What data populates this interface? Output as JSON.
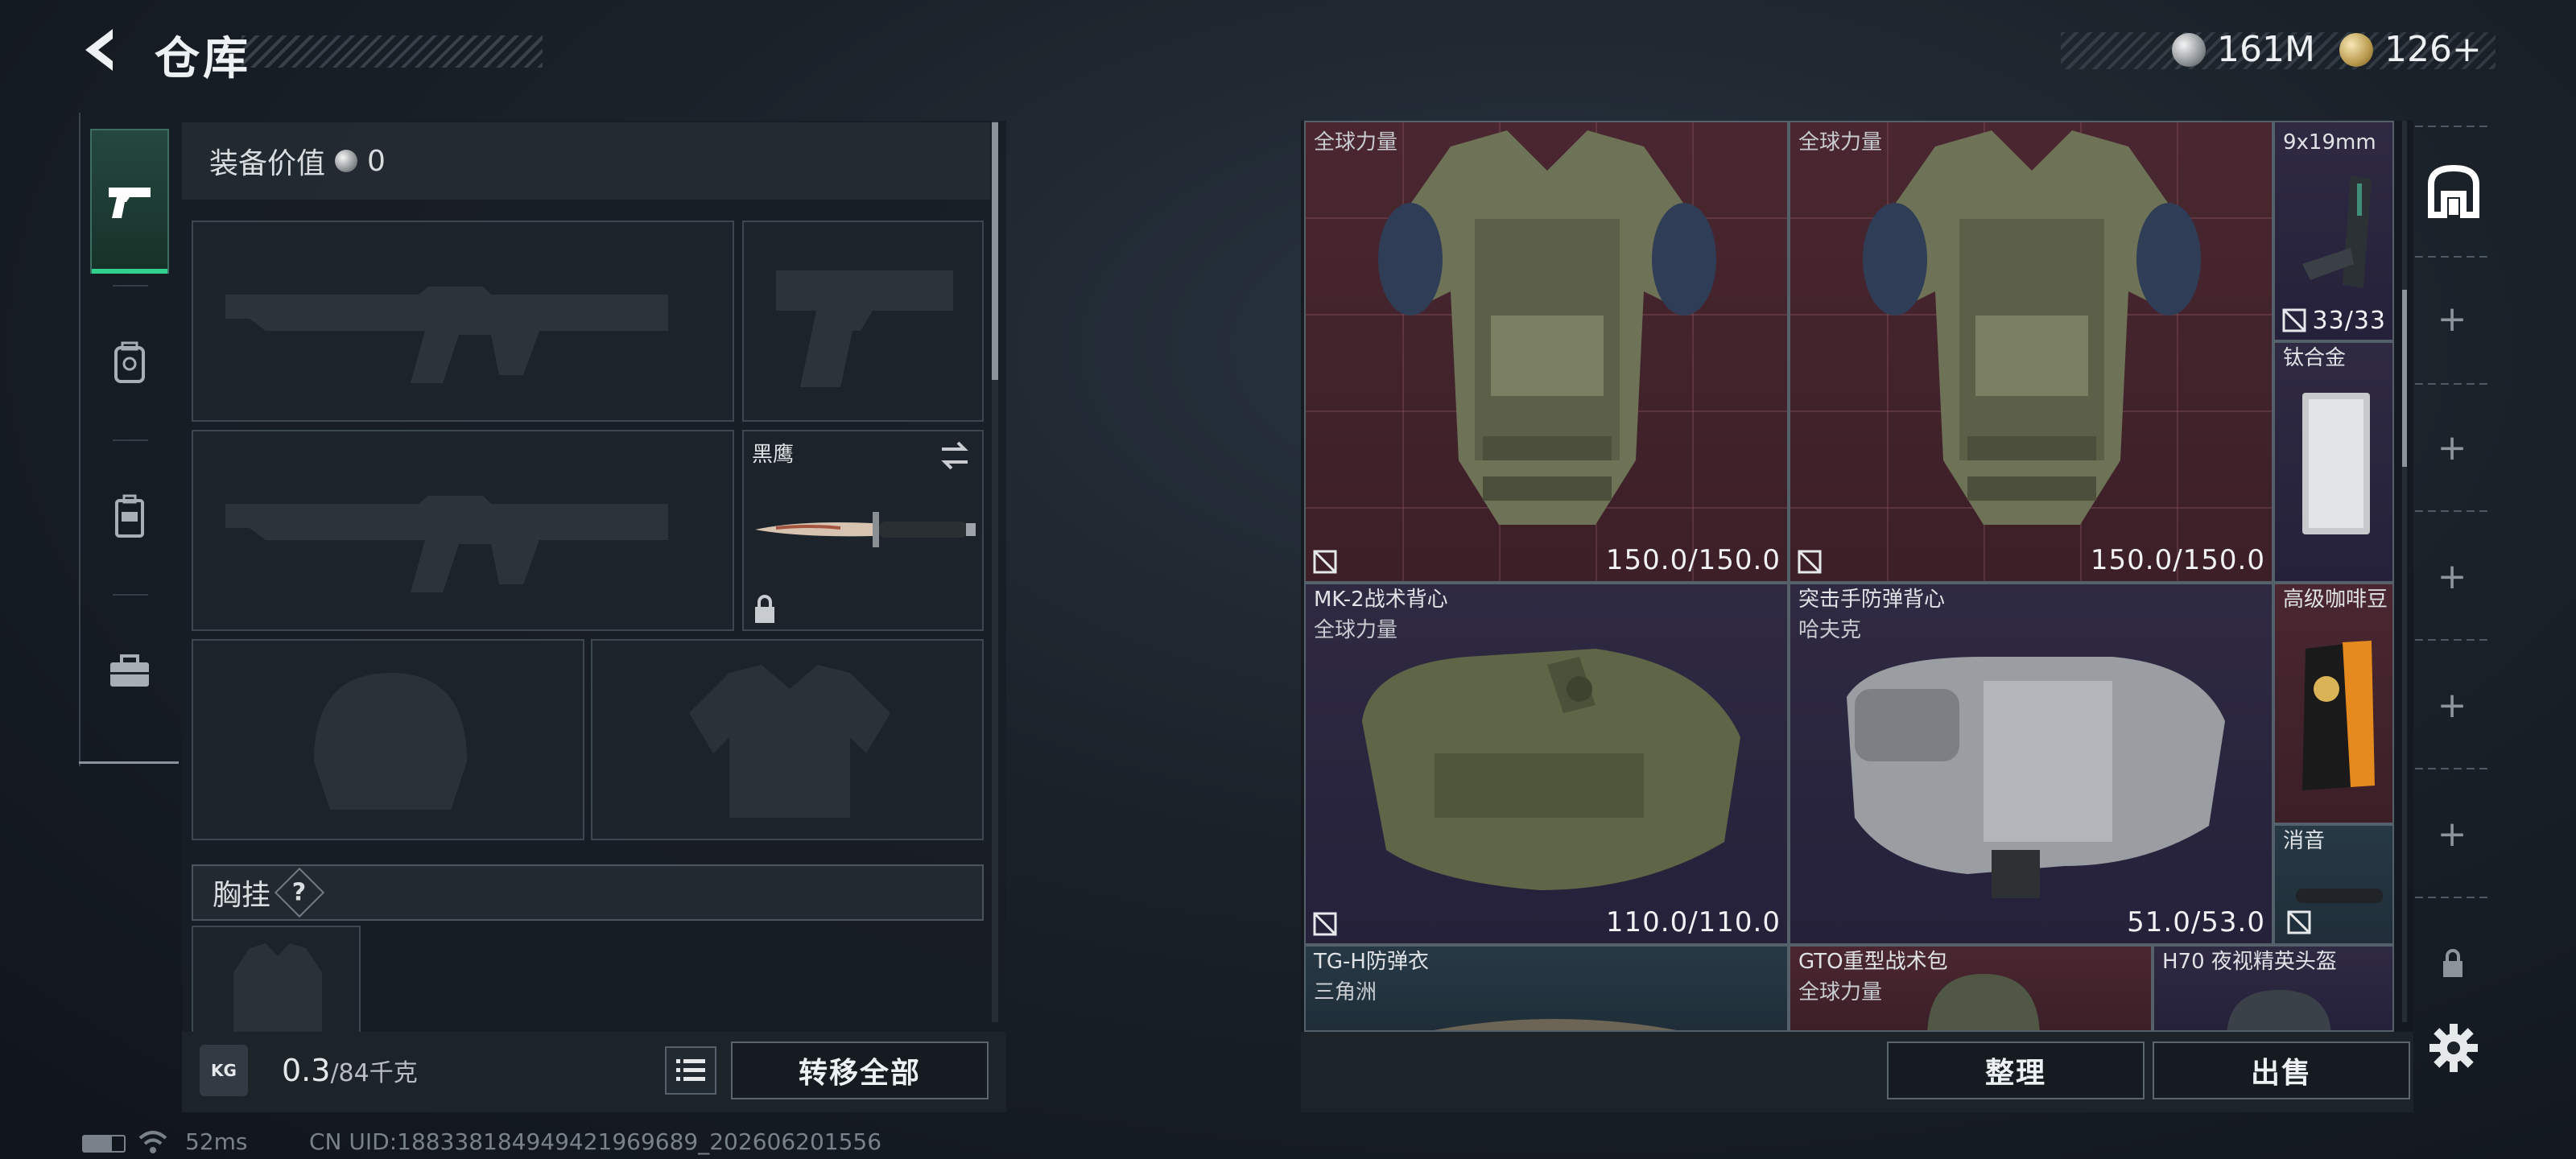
{
  "header": {
    "title": "仓库",
    "currency_silver": "161M",
    "currency_gold": "126+"
  },
  "loadout": {
    "equip_value_label": "装备价值",
    "equip_value": "0",
    "melee_name": "黑鹰",
    "chest_rig_label": "胸挂",
    "chest_rig_help": "?",
    "weight_value": "0.3",
    "weight_capacity": "/84千克",
    "kg_icon_text": "KG",
    "transfer_all_label": "转移全部"
  },
  "storage": {
    "items": [
      {
        "name": "",
        "sub": "全球力量",
        "durability": "150.0/150.0",
        "rarity": "red"
      },
      {
        "name": "",
        "sub": "全球力量",
        "durability": "150.0/150.0",
        "rarity": "red"
      },
      {
        "name": "",
        "sub": "9x19mm",
        "durability": "33/33",
        "rarity": "purple"
      },
      {
        "name": "钛合金",
        "sub": "",
        "durability": "",
        "rarity": "purple"
      },
      {
        "name": "MK-2战术背心",
        "sub": "全球力量",
        "durability": "110.0/110.0",
        "rarity": "purple"
      },
      {
        "name": "突击手防弹背心",
        "sub": "哈夫克",
        "durability": "51.0/53.0",
        "rarity": "purple"
      },
      {
        "name": "高级咖啡豆",
        "sub": "",
        "durability": "",
        "rarity": "red"
      },
      {
        "name": "消音",
        "sub": "",
        "durability": "",
        "rarity": "blue"
      },
      {
        "name": "TG-H防弹衣",
        "sub": "三角洲",
        "durability": "",
        "rarity": "blue"
      },
      {
        "name": "GTO重型战术包",
        "sub": "全球力量",
        "durability": "",
        "rarity": "red"
      },
      {
        "name": "H70 夜视精英头盔",
        "sub": "",
        "durability": "",
        "rarity": "purple"
      }
    ],
    "sort_label": "整理",
    "sell_label": "出售"
  },
  "status_bar": {
    "ping": "52ms",
    "uid": "CN UID:18833818494942196968​9_202606201556"
  },
  "colors": {
    "accent_green": "#31d18d",
    "rarity_red": "#4a2730",
    "rarity_purple": "#2f2a42",
    "rarity_blue": "#273945"
  }
}
